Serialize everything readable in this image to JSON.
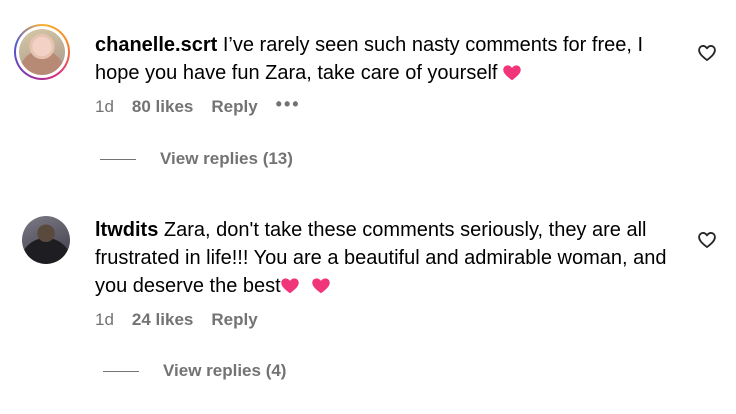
{
  "comments": [
    {
      "username": "chanelle.scrt",
      "text": "I’ve rarely seen such nasty comments for free, I hope you have fun Zara, take care of yourself",
      "emoji": "heart",
      "time": "1d",
      "likes": "80 likes",
      "reply_label": "Reply",
      "more_label": "•••",
      "view_replies": "View replies (13)",
      "has_story_ring": true
    },
    {
      "username": "ltwdits",
      "text": "Zara, don't take these comments seriously, they are all frustrated in life!!! You are a beautiful and admirable woman, and you deserve the best",
      "emoji": "heart",
      "time": "1d",
      "likes": "24 likes",
      "reply_label": "Reply",
      "view_replies": "View replies (4)",
      "has_story_ring": false
    }
  ],
  "colors": {
    "text": "#000000",
    "secondary": "#737373",
    "heart_emoji": "#f0357a"
  },
  "icons": {
    "like": "heart-outline-icon",
    "more": "more-horizontal-icon"
  }
}
